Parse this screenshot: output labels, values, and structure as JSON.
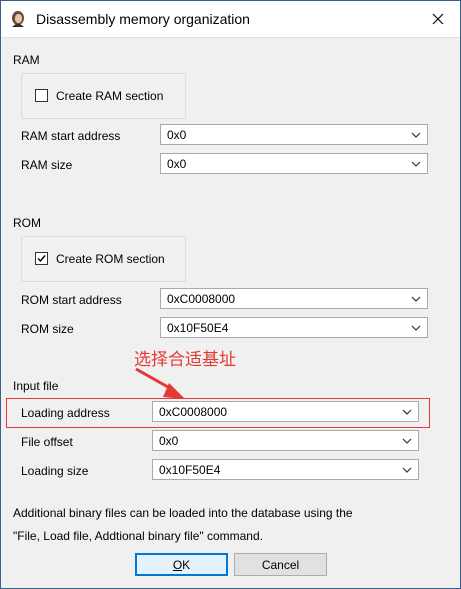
{
  "window": {
    "title": "Disassembly memory organization"
  },
  "ram": {
    "section_label": "RAM",
    "checkbox_label": "Create RAM section",
    "checked": false,
    "start_label": "RAM start address",
    "start_value": "0x0",
    "size_label": "RAM size",
    "size_value": "0x0"
  },
  "rom": {
    "section_label": "ROM",
    "checkbox_label": "Create ROM section",
    "checked": true,
    "start_label": "ROM start address",
    "start_value": "0xC0008000",
    "size_label": "ROM size",
    "size_value": "0x10F50E4"
  },
  "annotation": {
    "text": "选择合适基址",
    "color": "#e53935"
  },
  "input_file": {
    "section_label": "Input file",
    "loading_address_label": "Loading address",
    "loading_address_value": "0xC0008000",
    "file_offset_label": "File offset",
    "file_offset_value": "0x0",
    "loading_size_label": "Loading size",
    "loading_size_value": "0x10F50E4"
  },
  "info": {
    "line1": "Additional binary files can be loaded into the database using the",
    "line2": "\"File, Load file, Addtional binary file\" command."
  },
  "buttons": {
    "ok_prefix": "",
    "ok_mnemonic": "O",
    "ok_rest": "K",
    "cancel": "Cancel"
  },
  "icons": {
    "app": "ida-app-icon",
    "close": "close-icon",
    "dropdown": "chevron-down-icon",
    "check": "checkmark-icon"
  },
  "colors": {
    "accent": "#0078d7",
    "highlight": "#e53935",
    "dialog_bg": "#f0f0f0"
  }
}
